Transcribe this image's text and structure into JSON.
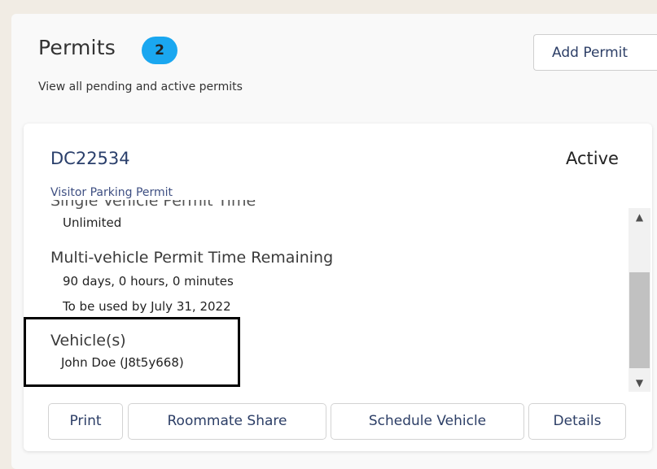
{
  "header": {
    "title": "Permits",
    "count": "2",
    "subtitle": "View all pending and active permits",
    "add_button": "Add Permit"
  },
  "permit": {
    "id": "DC22534",
    "status": "Active",
    "type": "Visitor Parking Permit",
    "cut_label": "Single Vehicle Permit Time",
    "single_time": "Unlimited",
    "multi_label": "Multi-vehicle Permit Time Remaining",
    "multi_time": "90 days, 0 hours, 0 minutes",
    "use_by": "To be used by July 31, 2022",
    "vehicles_label": "Vehicle(s)",
    "vehicle": "John Doe (J8t5y668)",
    "scrollbar_position": 0.55
  },
  "actions": {
    "print": "Print",
    "roommate_share": "Roommate Share",
    "schedule_vehicle": "Schedule Vehicle",
    "details": "Details"
  },
  "colors": {
    "badge": "#1aa7f0",
    "permit_id": "#2a3f6b",
    "button_text": "#2c3e66"
  }
}
